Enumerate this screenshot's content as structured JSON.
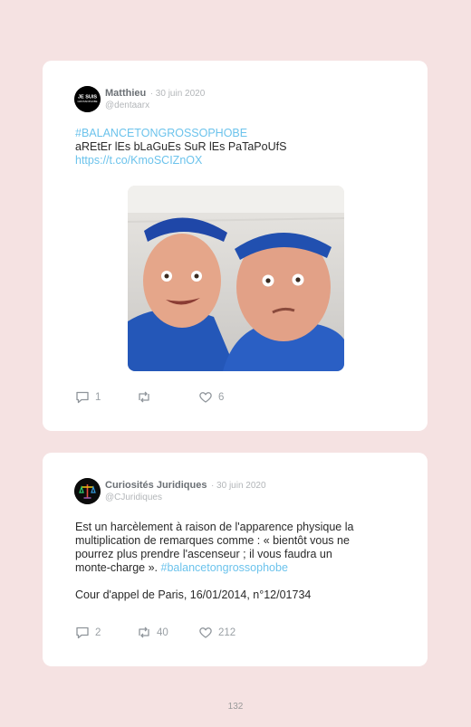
{
  "tweets": [
    {
      "name": "Matthieu",
      "date": "· 30 juin 2020",
      "handle": "@dentaarx",
      "avatar_text_top": "JE SUIS",
      "avatar_text_bottom": "GROSSOPHOBE",
      "hashtag": "#BALANCETONGROSSOPHOBE",
      "line2": "aREtEr lEs bLaGuEs SuR lEs PaTaPoUfS",
      "link": "https://t.co/KmoSCIZnOX",
      "replies": "1",
      "retweets": "",
      "likes": "6"
    },
    {
      "name": "Curiosités Juridiques",
      "date": "· 30 juin 2020",
      "handle": "@CJuridiques",
      "body_lines": [
        "Est un harcèlement à raison de l'apparence physique la",
        "multiplication de remarques comme : « bientôt vous ne",
        "pourrez plus prendre l'ascenseur ; il vous faudra un",
        "monte-charge ». "
      ],
      "body_hashtag": "#balancetongrossophobe",
      "citation": "Cour d'appel de Paris, 16/01/2014, n°12/01734",
      "replies": "2",
      "retweets": "40",
      "likes": "212"
    }
  ],
  "page_number": "132",
  "colors": {
    "background": "#f5e2e2",
    "link": "#6cc3ec",
    "text": "#2a2a2a"
  },
  "icons": [
    "reply-icon",
    "retweet-icon",
    "like-icon"
  ]
}
